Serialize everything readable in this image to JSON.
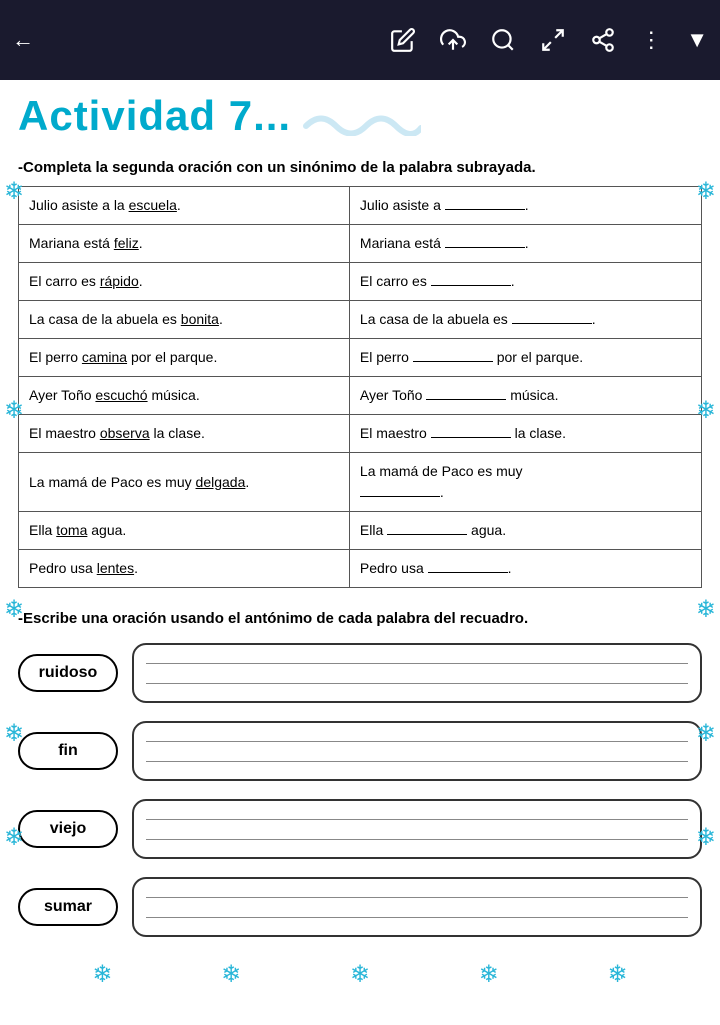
{
  "toolbar": {
    "back_icon": "←",
    "edit_icon": "✏",
    "upload_icon": "⬆",
    "search_icon": "🔍",
    "expand_icon": "⛶",
    "share_icon": "⎇",
    "more_icon": "⋮",
    "dropdown_icon": "▼"
  },
  "title": "Actividad 7...",
  "section1": {
    "instruction": "-Completa la segunda oración con un sinónimo de la palabra subrayada.",
    "rows": [
      {
        "left": "Julio asiste a la escuela.",
        "left_underline": "escuela",
        "right_prefix": "Julio asiste a ",
        "right_suffix": "."
      },
      {
        "left": "Mariana está feliz.",
        "left_underline": "feliz",
        "right_prefix": "Mariana está ",
        "right_suffix": "."
      },
      {
        "left": "El carro es rápido.",
        "left_underline": "rápido",
        "right_prefix": "El carro es ",
        "right_suffix": "."
      },
      {
        "left": "La casa de la abuela es bonita.",
        "left_underline": "bonita",
        "right_prefix": "La casa de la abuela es ",
        "right_suffix": "."
      },
      {
        "left": "El perro camina por el parque.",
        "left_underline": "camina",
        "right_prefix": "El perro ",
        "right_middle": " por el parque.",
        "right_suffix": ""
      },
      {
        "left": "Ayer Toño escuchó música.",
        "left_underline": "escuchó",
        "right_prefix": "Ayer Toño ",
        "right_middle": " música.",
        "right_suffix": ""
      },
      {
        "left": "El maestro observa la clase.",
        "left_underline": "observa",
        "right_prefix": "El maestro ",
        "right_middle": " la clase.",
        "right_suffix": ""
      },
      {
        "left": "La mamá de Paco es muy delgada.",
        "left_underline": "delgada",
        "right_prefix": "La mamá de Paco es muy",
        "right_suffix": "."
      },
      {
        "left": "Ella toma agua.",
        "left_underline": "toma",
        "right_prefix": "Ella ",
        "right_middle": " agua.",
        "right_suffix": ""
      },
      {
        "left": "Pedro usa lentes.",
        "left_underline": "lentes",
        "right_prefix": "Pedro usa ",
        "right_suffix": "."
      }
    ]
  },
  "section2": {
    "instruction": "-Escribe una oración usando el antónimo de cada palabra del recuadro.",
    "words": [
      "ruidoso",
      "fin",
      "viejo",
      "sumar"
    ]
  },
  "snowflake_char": "❄"
}
